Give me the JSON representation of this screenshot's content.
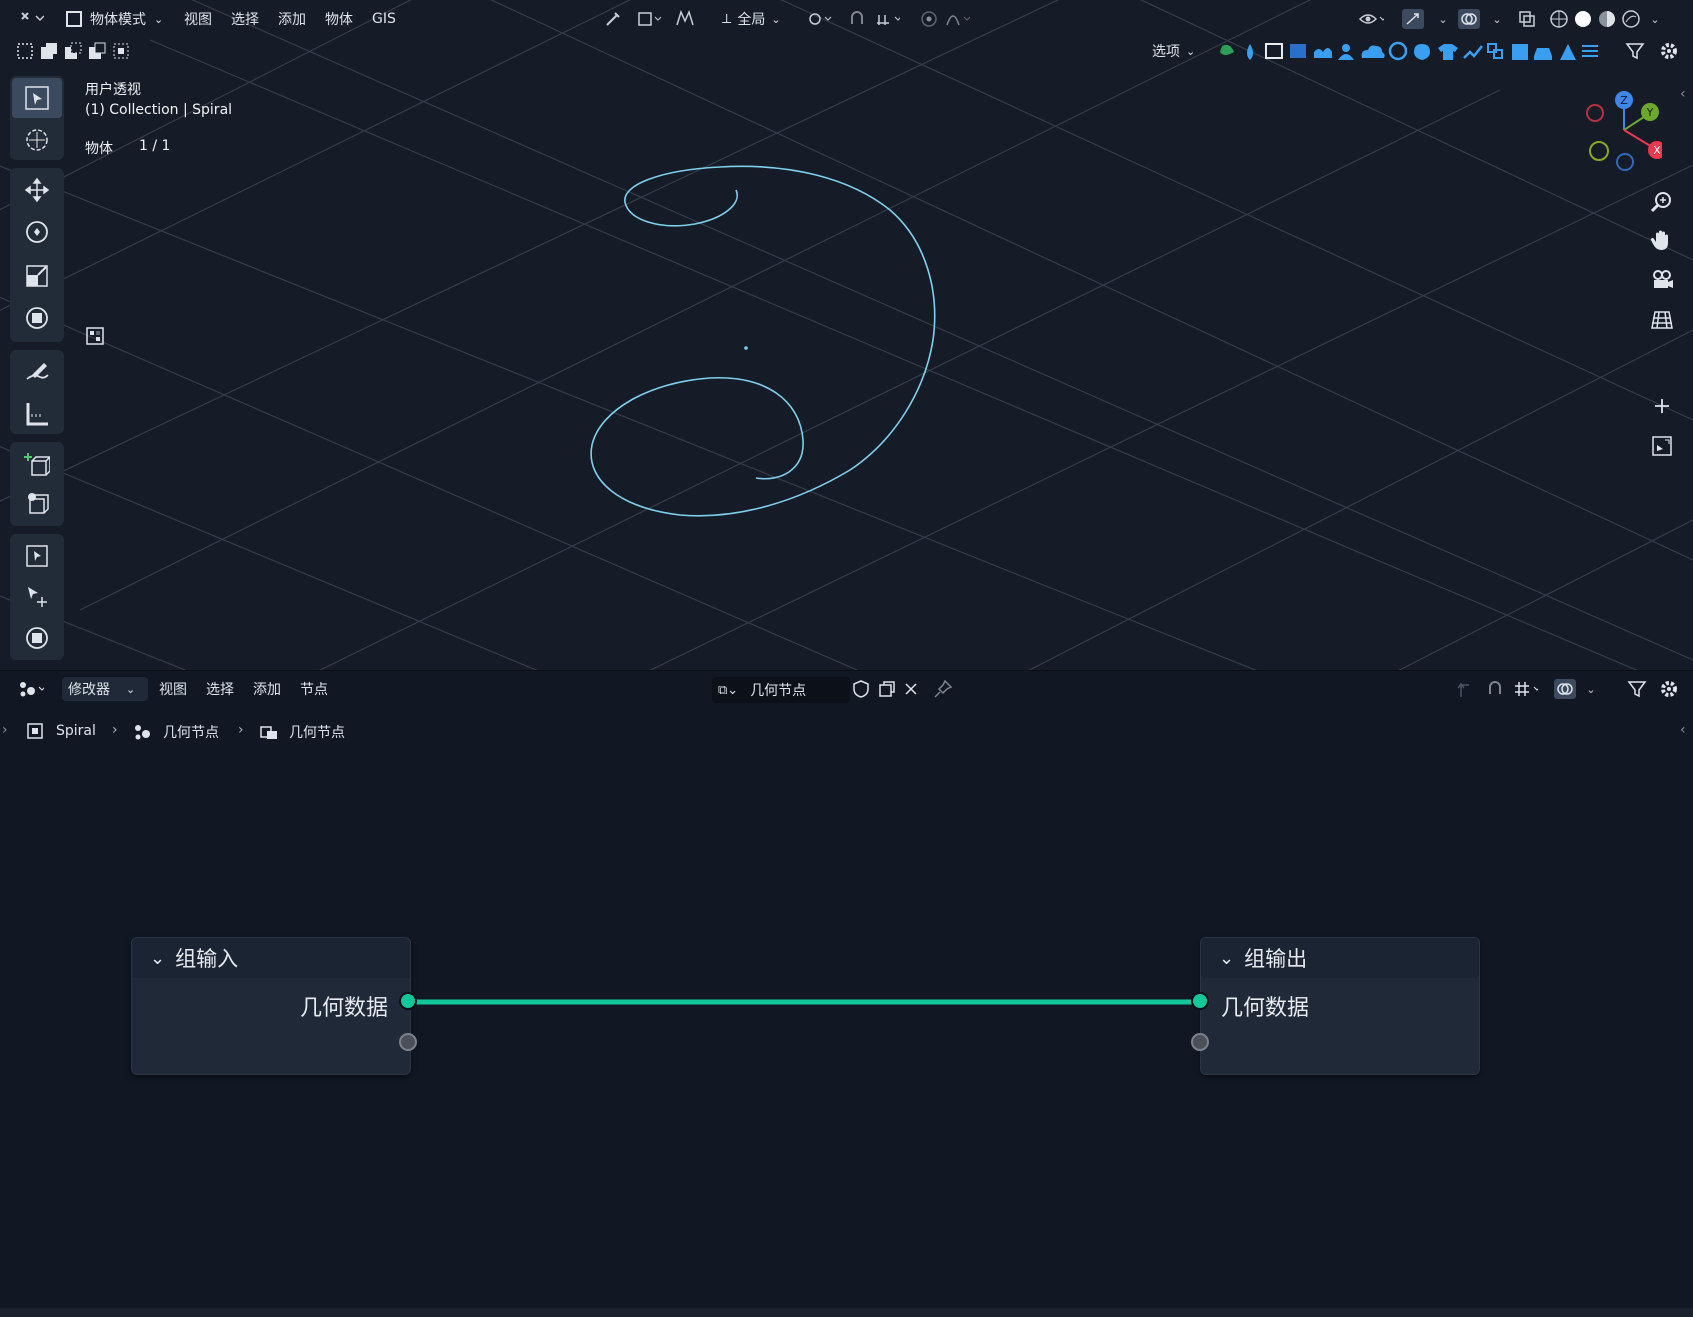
{
  "viewport": {
    "header": {
      "mode_label": "物体模式",
      "menus": [
        "视图",
        "选择",
        "添加",
        "物体",
        "GIS"
      ],
      "transform_orientation": "全局",
      "options_label": "选项"
    },
    "overlay": {
      "view_name": "用户透视",
      "collection_line": "(1) Collection | Spiral",
      "objects_label": "物体",
      "objects_count": "1 / 1"
    },
    "gizmo": {
      "z": "Z",
      "y": "Y",
      "x": "X"
    },
    "colors": {
      "curve": "#7fd0ee",
      "grid": "#39424f",
      "background": "#151c27"
    }
  },
  "node_editor": {
    "header": {
      "editor_type_label": "修改器",
      "menus": [
        "视图",
        "选择",
        "添加",
        "节点"
      ],
      "node_group_name": "几何节点"
    },
    "breadcrumb": [
      "Spiral",
      "几何节点",
      "几何节点"
    ],
    "nodes": {
      "group_input": {
        "title": "组输入",
        "socket_label": "几何数据"
      },
      "group_output": {
        "title": "组输出",
        "socket_label": "几何数据"
      }
    },
    "colors": {
      "geometry_link": "#14c79a"
    }
  }
}
